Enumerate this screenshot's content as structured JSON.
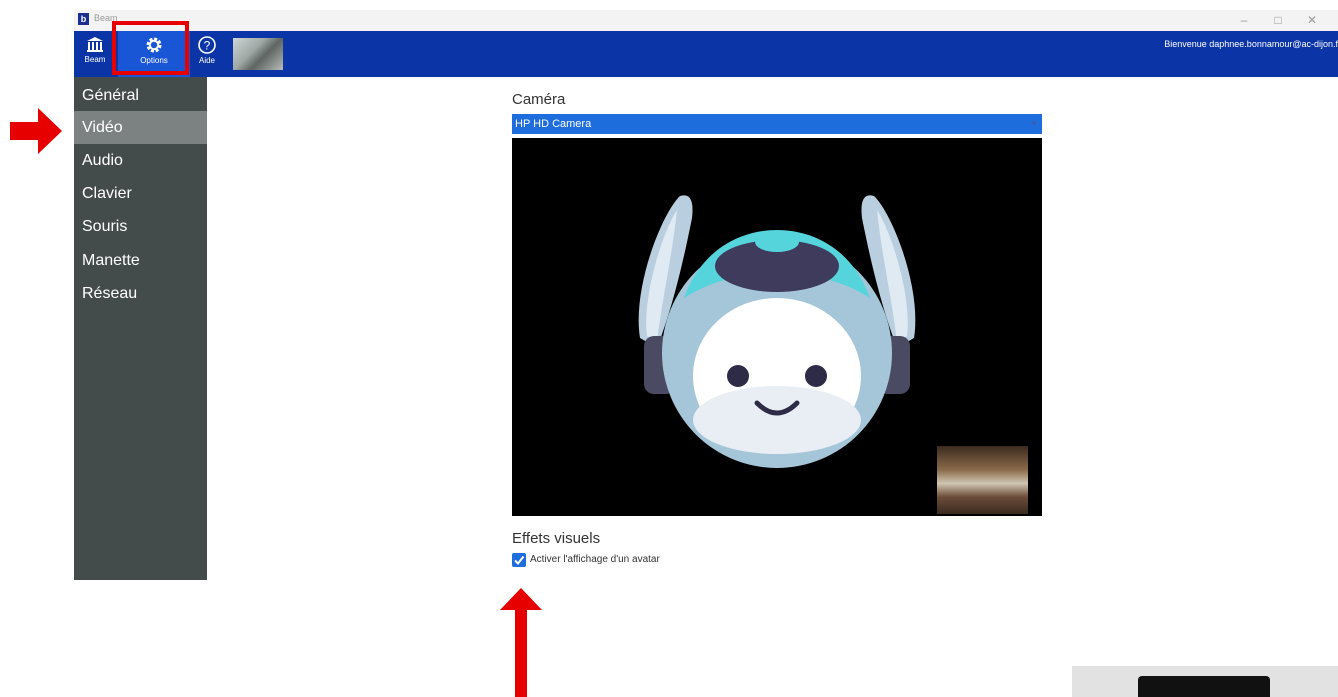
{
  "window": {
    "title": "Beam"
  },
  "toolbar": {
    "beam_label": "Beam",
    "options_label": "Options",
    "aide_label": "Aide",
    "welcome": "Bienvenue daphnee.bonnamour@ac-dijon.f"
  },
  "sidebar": {
    "items": [
      {
        "label": "Général"
      },
      {
        "label": "Vidéo",
        "active": true
      },
      {
        "label": "Audio"
      },
      {
        "label": "Clavier"
      },
      {
        "label": "Souris"
      },
      {
        "label": "Manette"
      },
      {
        "label": "Réseau"
      }
    ]
  },
  "camera": {
    "heading": "Caméra",
    "selected": "HP HD Camera"
  },
  "effects": {
    "heading": "Effets visuels",
    "avatar_label": "Activer l'affichage d'un avatar",
    "avatar_checked": true
  },
  "colors": {
    "toolbar": "#0b34a6",
    "accent": "#1e6ddc",
    "sidebar": "#444b4b",
    "sidebar_active": "#7b8281",
    "annotation": "#e60000"
  },
  "icons": [
    "beam-logo-icon",
    "gear-icon",
    "help-icon",
    "dropdown-caret-icon",
    "checkmark-icon",
    "minimize-icon",
    "maximize-icon",
    "close-icon"
  ]
}
